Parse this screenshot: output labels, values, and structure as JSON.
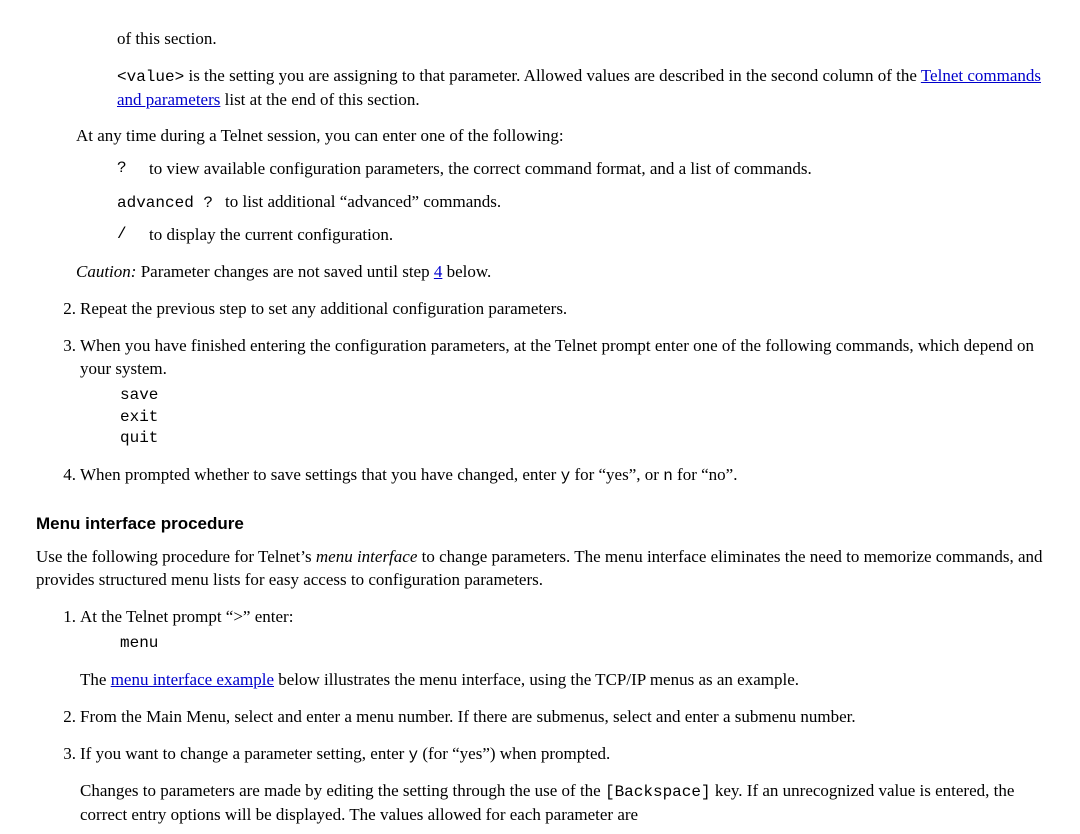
{
  "top": {
    "frag_of_section": "of this section.",
    "value_token": "<value>",
    "value_desc_1": " is the setting you are assigning to that parameter. Allowed values are described in the second column of the ",
    "value_link": "Telnet commands and parameters",
    "value_desc_2": " list at the end of this section."
  },
  "any_time": "At any time during a Telnet session, you can enter one of the following:",
  "help_rows": {
    "q": "?",
    "q_desc": "to view available configuration parameters, the correct command format, and a list of commands.",
    "adv": "advanced ?",
    "adv_desc": "to list additional “advanced” commands.",
    "slash": "/",
    "slash_desc": "to display the current configuration."
  },
  "caution": {
    "label": "Caution:",
    "text_1": "  Parameter changes are not saved until step ",
    "link": "4",
    "text_2": " below."
  },
  "step2": "Repeat the previous step to set any additional configuration parameters.",
  "step3": "When you have finished entering the configuration parameters, at the Telnet prompt enter one of the following commands, which depend on your system.",
  "cmds": {
    "save": "save",
    "exit": "exit",
    "quit": "quit"
  },
  "step4_a": "When prompted whether to save settings that you have changed, enter ",
  "y": "y",
  "step4_b": " for “yes”, or ",
  "n": "n",
  "step4_c": " for “no”.",
  "heading": "Menu interface procedure",
  "menu_intro_a": "Use the following procedure for Telnet’s ",
  "menu_intro_i": "menu interface",
  "menu_intro_b": " to change parameters. The menu interface eliminates the need to memorize commands, and provides structured menu lists for easy access to configuration parameters.",
  "m1": "At the Telnet prompt “>” enter:",
  "menu_cmd": "menu",
  "m1b_a": "The ",
  "m1b_link": "menu interface example",
  "m1b_b": " below illustrates the menu interface, using the TCP/IP menus as an example.",
  "m2": "From the Main Menu, select and enter a menu number. If there are submenus, select and enter a submenu number.",
  "m3_a": "If you want to change a parameter setting, enter ",
  "m3_b": " (for “yes”) when prompted.",
  "m3p_a": "Changes to parameters are made by editing the setting through the use of the ",
  "bksp": "[Backspace]",
  "m3p_b": " key. If an unrecognized value is entered, the correct entry options will be displayed. The values allowed for each parameter are",
  "nums": {
    "n1": "1.",
    "n2": "2.",
    "n3": "3.",
    "n4": "4."
  }
}
